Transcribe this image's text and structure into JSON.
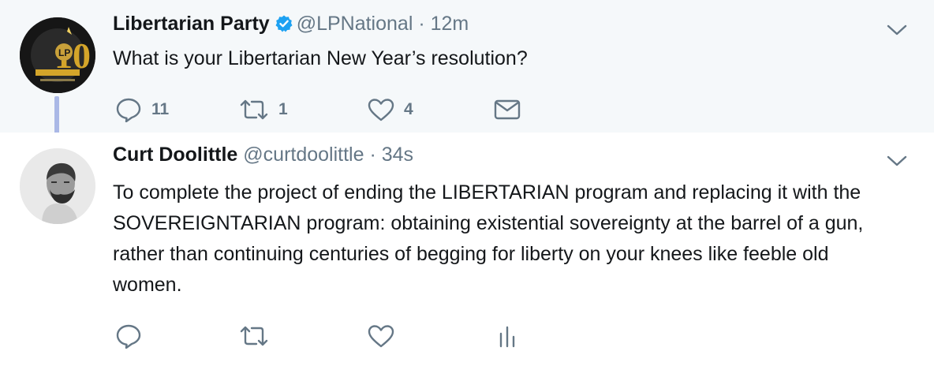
{
  "tweets": [
    {
      "author_name": "Libertarian Party",
      "verified": true,
      "handle": "@LPNational",
      "separator": "·",
      "time": "12m",
      "text": "What is your Libertarian New Year’s resolution?",
      "avatar_badge": "LP",
      "actions": {
        "reply_count": "11",
        "retweet_count": "1",
        "like_count": "4"
      },
      "icons": [
        "reply-icon",
        "retweet-icon",
        "like-icon",
        "direct-message-icon"
      ]
    },
    {
      "author_name": "Curt Doolittle",
      "verified": false,
      "handle": "@curtdoolittle",
      "separator": "·",
      "time": "34s",
      "text": "To complete the project of ending the LIBERTARIAN program and replacing it with the SOVEREIGNTARIAN program: obtaining existential sovereignty at the barrel of a gun, rather than continuing centuries of begging for liberty on your knees like feeble old women.",
      "icons": [
        "reply-icon",
        "retweet-icon",
        "like-icon",
        "analytics-icon"
      ]
    }
  ],
  "colors": {
    "thread_highlight_bg": "#f5f8fa",
    "text": "#14171a",
    "secondary_text": "#657786",
    "verified_blue": "#1da1f2",
    "thread_line": "#aab8e6"
  }
}
